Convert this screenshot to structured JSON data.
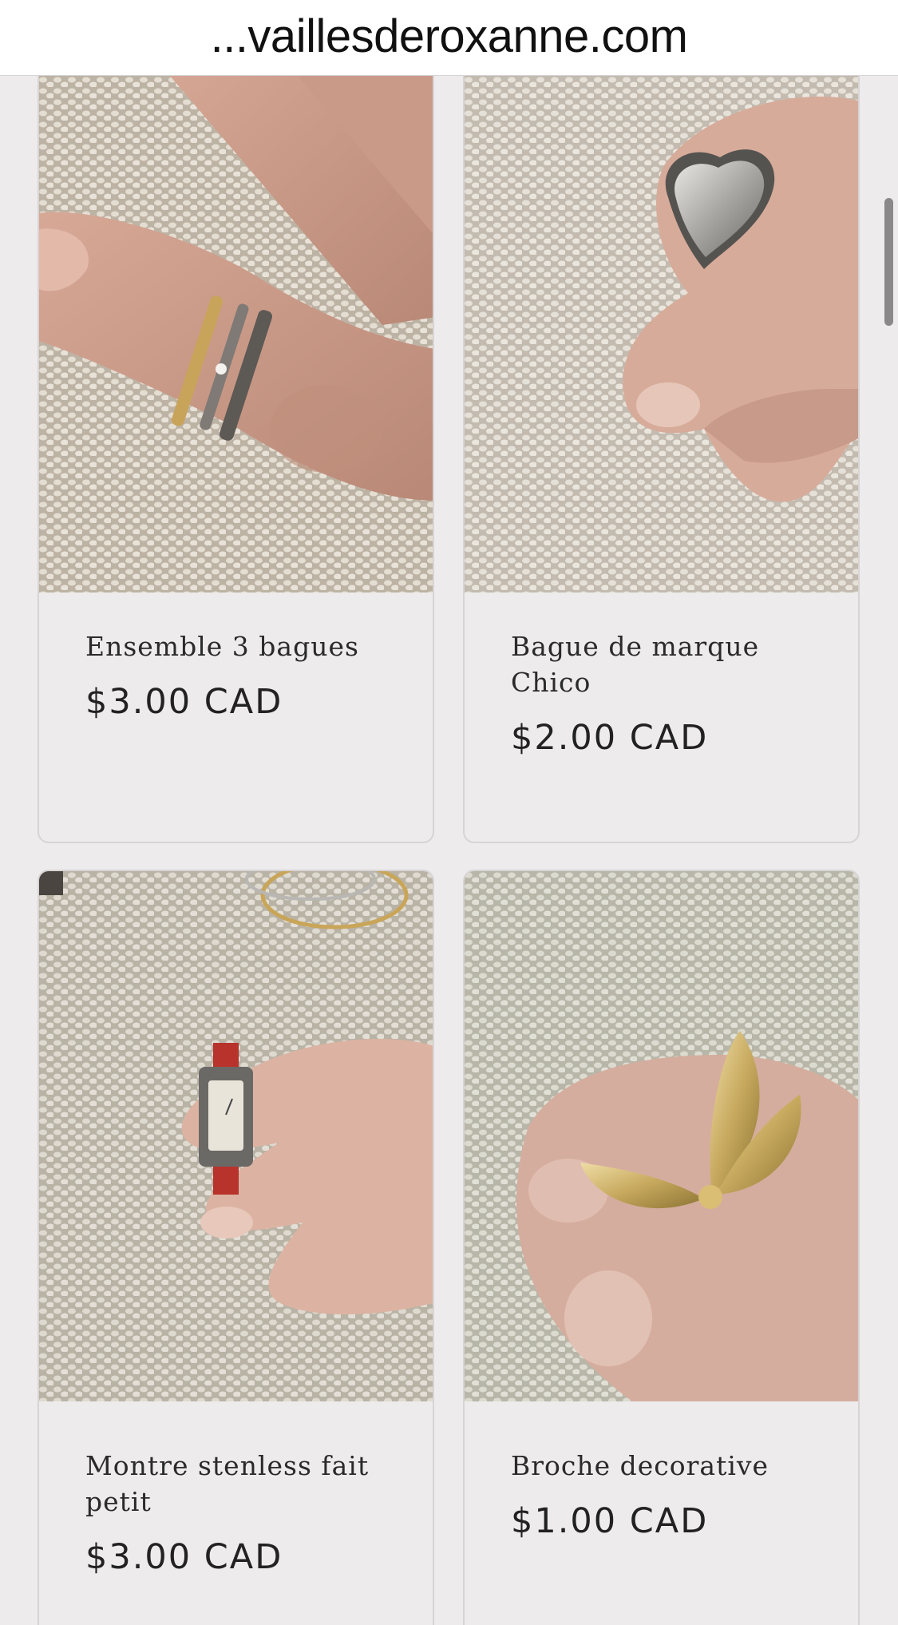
{
  "browser": {
    "url": "...vaillesderoxanne.com"
  },
  "products": [
    {
      "title": "Ensemble 3 bagues",
      "price": "$3.00 CAD",
      "image_icon": "rings-photo"
    },
    {
      "title": "Bague de marque Chico",
      "price": "$2.00 CAD",
      "image_icon": "heart-ring-photo"
    },
    {
      "title": "Montre stenless fait petit",
      "price": "$3.00 CAD",
      "image_icon": "watch-photo"
    },
    {
      "title": "Broche decorative",
      "price": "$1.00 CAD",
      "image_icon": "brooch-photo"
    }
  ],
  "colors": {
    "page_bg": "#eeebec",
    "card_border": "#d8d4d5",
    "text": "#2a2a2a"
  }
}
